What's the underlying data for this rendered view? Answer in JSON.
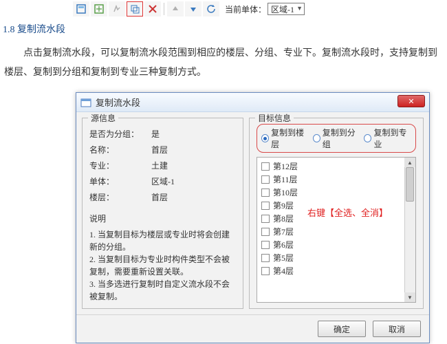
{
  "toolbar": {
    "current_unit_label": "当前单体：",
    "current_unit_value": "区域-1"
  },
  "section_title": "1.8 复制流水段",
  "paragraph": "点击复制流水段，可以复制流水段范围到相应的楼层、分组、专业下。复制流水段时，支持复制到楼层、复制到分组和复制到专业三种复制方式。",
  "dialog": {
    "title": "复制流水段",
    "source": {
      "title": "源信息",
      "rows": [
        {
          "label": "是否为分组：",
          "value": "是"
        },
        {
          "label": "名称：",
          "value": "首层"
        },
        {
          "label": "专业：",
          "value": "土建"
        },
        {
          "label": "单体：",
          "value": "区域-1"
        },
        {
          "label": "楼层：",
          "value": "首层"
        }
      ],
      "desc_label": "说明",
      "desc_items": [
        "1. 当复制目标为楼层或专业时将会创建新的分组。",
        "2. 当复制目标为专业时构件类型不会被复制，需要重新设置关联。",
        "3. 当多选进行复制时自定义流水段不会被复制。"
      ]
    },
    "target": {
      "title": "目标信息",
      "radios": [
        {
          "label": "复制到楼层",
          "checked": true
        },
        {
          "label": "复制到分组",
          "checked": false
        },
        {
          "label": "复制到专业",
          "checked": false
        }
      ],
      "floors": [
        "第12层",
        "第11层",
        "第10层",
        "第9层",
        "第8层",
        "第7层",
        "第6层",
        "第5层",
        "第4层"
      ],
      "overlay_note": "右键【全选、全消】"
    },
    "buttons": {
      "ok": "确定",
      "cancel": "取消"
    }
  }
}
